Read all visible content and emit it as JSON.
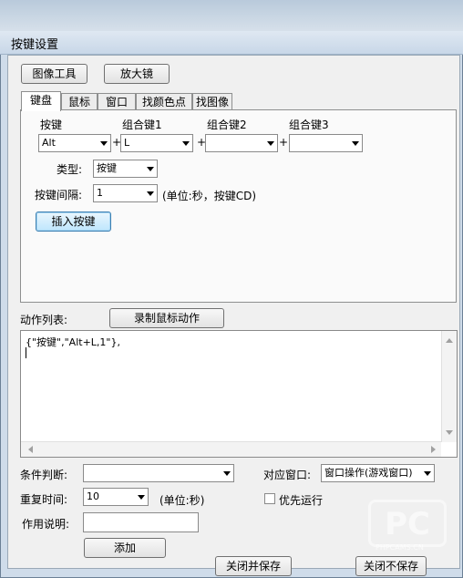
{
  "window": {
    "title": "按键设置"
  },
  "toolbar": {
    "image_tool_label": "图像工具",
    "magnifier_label": "放大镜"
  },
  "tabs": [
    {
      "label": "键盘"
    },
    {
      "label": "鼠标"
    },
    {
      "label": "窗口"
    },
    {
      "label": "找颜色点"
    },
    {
      "label": "找图像"
    }
  ],
  "keyboard": {
    "key_header": "按键",
    "combo1_header": "组合键1",
    "combo2_header": "组合键2",
    "combo3_header": "组合键3",
    "key_value": "Alt",
    "combo1_value": "L",
    "combo2_value": "",
    "combo3_value": "",
    "plus": "+",
    "type_label": "类型:",
    "type_value": "按键",
    "interval_label": "按键间隔:",
    "interval_value": "1",
    "interval_unit": "(单位:秒，按键CD)",
    "insert_button": "插入按键"
  },
  "actions": {
    "list_label": "动作列表:",
    "record_button": "录制鼠标动作",
    "content": "{\"按键\",\"Alt+L,1\"},"
  },
  "bottom": {
    "condition_label": "条件判断:",
    "condition_value": "",
    "window_label": "对应窗口:",
    "window_value": "窗口操作(游戏窗口)",
    "repeat_label": "重复时间:",
    "repeat_value": "10",
    "repeat_unit": "(单位:秒)",
    "priority_label": "优先运行",
    "description_label": "作用说明:",
    "description_value": "",
    "add_button": "添加",
    "close_save_button": "关闭并保存",
    "close_nosave_button": "关闭不保存"
  },
  "watermark": {
    "logo": "PC",
    "sub": "PHPCAMS.CN"
  }
}
